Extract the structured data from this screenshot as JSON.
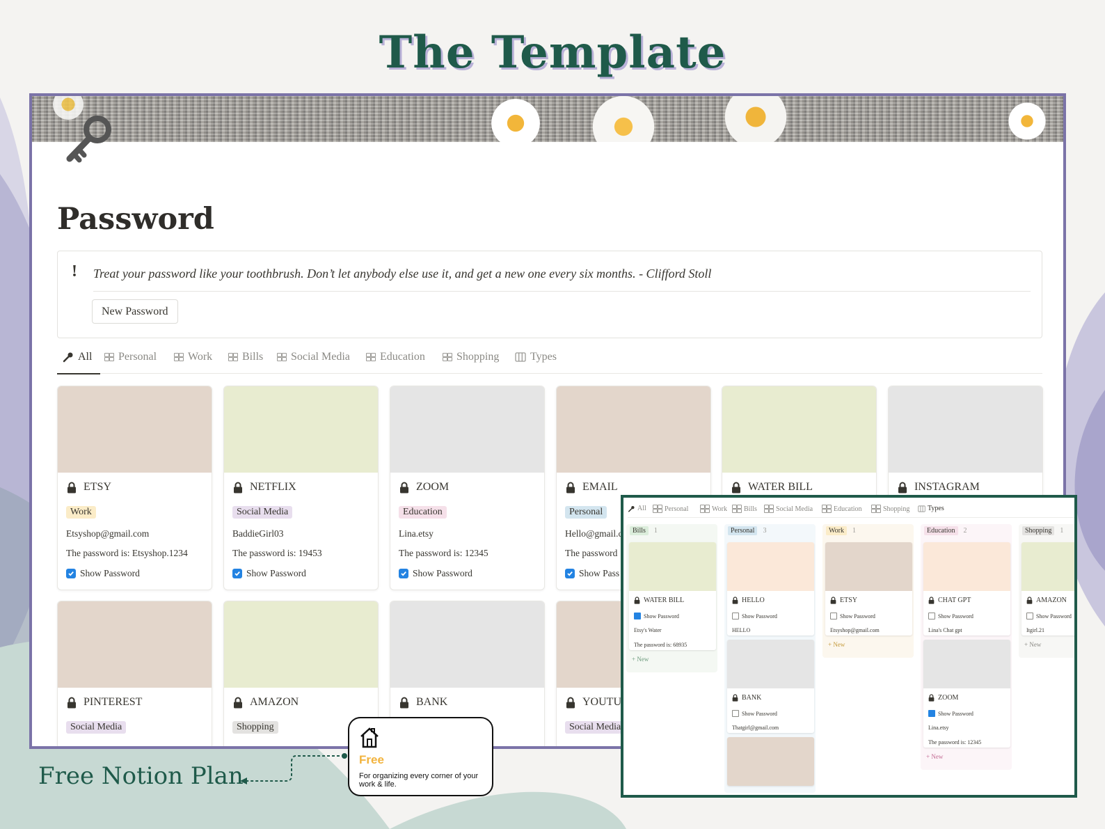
{
  "headline": "The Template",
  "page": {
    "title": "Password",
    "icon": "key-icon",
    "callout": {
      "icon": "!",
      "quote": "Treat your password like your toothbrush. Don’t let anybody else use it, and get a new one every six months. - Clifford Stoll",
      "button": "New Password"
    },
    "tabs": [
      "All",
      "Personal",
      "Work",
      "Bills",
      "Social Media",
      "Education",
      "Shopping",
      "Types"
    ],
    "active_tab": "All",
    "cards": [
      {
        "title": "ETSY",
        "tag": "Work",
        "tag_color": "#fbecc8",
        "cover": "#e3d6cb",
        "account": "Etsyshop@gmail.com",
        "password": "The password is: Etsyshop.1234",
        "show": "Show Password"
      },
      {
        "title": "NETFLIX",
        "tag": "Social Media",
        "tag_color": "#e8deee",
        "cover": "#e8ecd0",
        "account": "BaddieGirl03",
        "password": "The password is: 19453",
        "show": "Show Password"
      },
      {
        "title": "ZOOM",
        "tag": "Education",
        "tag_color": "#f5e0e9",
        "cover": "#e5e5e5",
        "account": "Lina.etsy",
        "password": "The password is: 12345",
        "show": "Show Password"
      },
      {
        "title": "EMAIL",
        "tag": "Personal",
        "tag_color": "#d3e5ef",
        "cover": "#e3d6cb",
        "account": "Hello@gmail.c",
        "password": "The password",
        "show": "Show Pass"
      },
      {
        "title": "WATER BILL",
        "cover": "#e8ecd0"
      },
      {
        "title": "INSTAGRAM",
        "cover": "#e5e5e5"
      },
      {
        "title": "PINTEREST",
        "tag": "Social Media",
        "tag_color": "#e8deee",
        "cover": "#e3d6cb"
      },
      {
        "title": "AMAZON",
        "tag": "Shopping",
        "tag_color": "#e3e2e0",
        "cover": "#e8ecd0"
      },
      {
        "title": "BANK",
        "cover": "#e5e5e5"
      },
      {
        "title": "YOUTU",
        "tag": "Social Media",
        "tag_color": "#e8deee",
        "cover": "#e3d6cb"
      }
    ]
  },
  "board": {
    "tabs": [
      "All",
      "Personal",
      "Work",
      "Bills",
      "Social Media",
      "Education",
      "Shopping",
      "Types"
    ],
    "active_tab": "Types",
    "new_label": "New",
    "columns": [
      {
        "name": "Bills",
        "count": "1",
        "label_color": "#dbeddb",
        "bg": "#f4f8f3",
        "new_color": "#6c9b7d",
        "cards": [
          {
            "title": "WATER BILL",
            "cover": "#e8ecd0",
            "checked": true,
            "show": "Show Password",
            "lines": [
              "Etsy's Water",
              "The password is: 68935"
            ]
          }
        ]
      },
      {
        "name": "Personal",
        "count": "3",
        "label_color": "#d3e5ef",
        "bg": "#f3f8fb",
        "new_color": "#5e87a6",
        "cards": [
          {
            "title": "HELLO",
            "cover": "#fbe8d9",
            "checked": false,
            "show": "Show Password",
            "lines": [
              "HELLO"
            ]
          },
          {
            "title": "BANK",
            "cover": "#e5e5e5",
            "checked": false,
            "show": "Show Password",
            "lines": [
              "Thatgirl@gmail.com"
            ]
          },
          {
            "title": "",
            "cover": "#e3d6cb",
            "checked": false,
            "show": "",
            "lines": []
          }
        ]
      },
      {
        "name": "Work",
        "count": "1",
        "label_color": "#fbecc8",
        "bg": "#fcf7ee",
        "new_color": "#c49a3a",
        "cards": [
          {
            "title": "ETSY",
            "cover": "#e3d6cb",
            "checked": false,
            "show": "Show Password",
            "lines": [
              "Etsyshop@gmail.com"
            ]
          }
        ]
      },
      {
        "name": "Education",
        "count": "2",
        "label_color": "#f5e0e9",
        "bg": "#fcf5f8",
        "new_color": "#c36b93",
        "cards": [
          {
            "title": "CHAT GPT",
            "cover": "#fbe8d9",
            "checked": false,
            "show": "Show Password",
            "lines": [
              "Lina's Chat gpt"
            ]
          },
          {
            "title": "ZOOM",
            "cover": "#e5e5e5",
            "checked": true,
            "show": "Show Password",
            "lines": [
              "Lina.etsy",
              "The password is: 12345"
            ]
          }
        ]
      },
      {
        "name": "Shopping",
        "count": "1",
        "label_color": "#e3e2e0",
        "bg": "#f7f7f5",
        "new_color": "#8a8984",
        "cards": [
          {
            "title": "AMAZON",
            "cover": "#e8ecd0",
            "checked": false,
            "show": "Show Password",
            "lines": [
              "Itgirl.21"
            ]
          }
        ]
      }
    ]
  },
  "free_plan": {
    "label": "Free Notion Plan",
    "card_title": "Free",
    "card_desc": "For organizing every corner of your work & life.",
    "icon": "house-icon"
  }
}
